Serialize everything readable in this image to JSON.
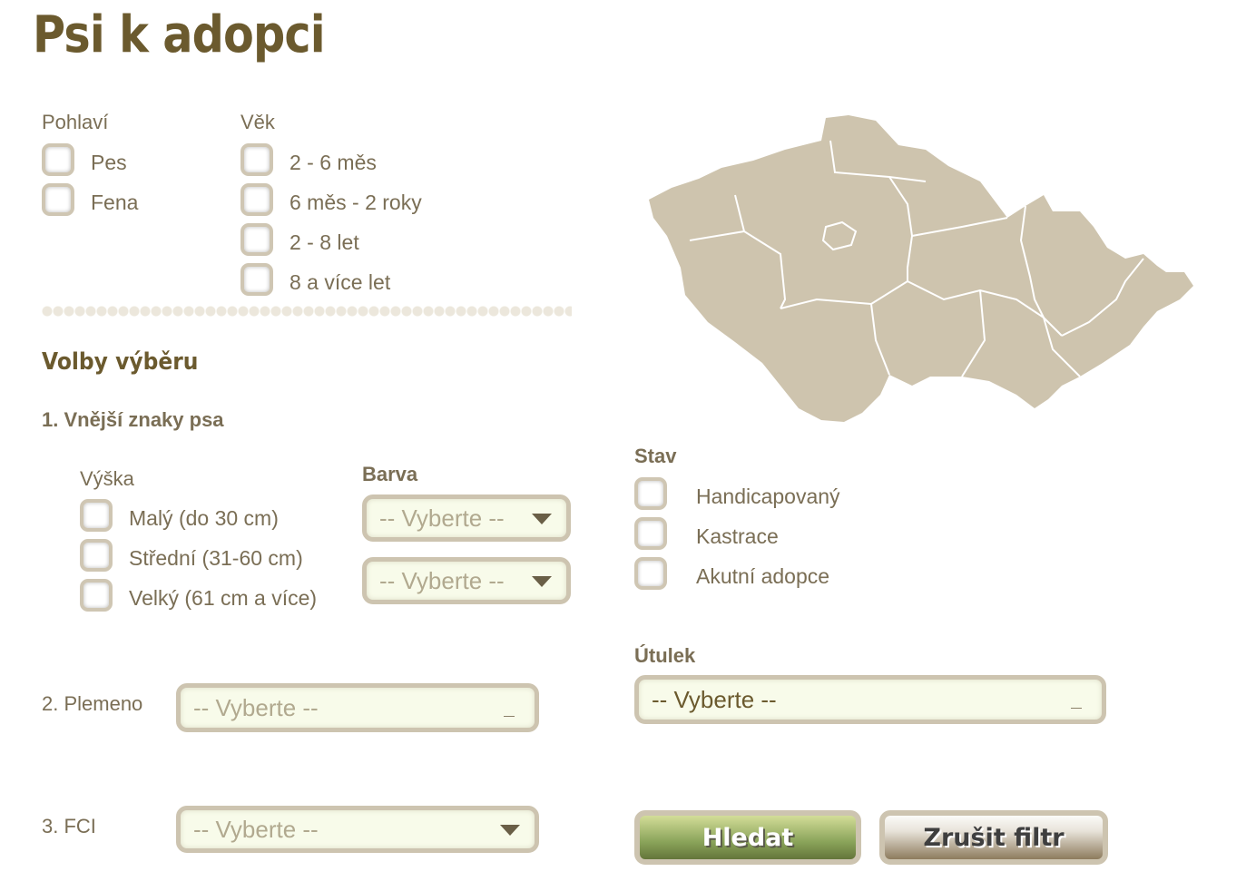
{
  "title": "Psi k adopci",
  "gender": {
    "label": "Pohlaví",
    "options": [
      "Pes",
      "Fena"
    ]
  },
  "age": {
    "label": "Věk",
    "options": [
      "2 - 6 měs",
      "6 měs - 2 roky",
      "2 - 8 let",
      "8 a více let"
    ]
  },
  "section_title": "Volby výběru",
  "external": {
    "label": "1. Vnější znaky psa",
    "height_label": "Výška",
    "heights": [
      "Malý (do 30 cm)",
      "Střední (31-60 cm)",
      "Velký (61 cm a více)"
    ],
    "color_label": "Barva",
    "color_selects": [
      "-- Vyberte --",
      "-- Vyberte --"
    ]
  },
  "breed": {
    "label": "2. Plemeno",
    "value": "-- Vyberte --"
  },
  "fci": {
    "label": "3. FCI",
    "value": "-- Vyberte --"
  },
  "status": {
    "label": "Stav",
    "options": [
      "Handicapovaný",
      "Kastrace",
      "Akutní adopce"
    ]
  },
  "shelter": {
    "label": "Útulek",
    "value": "-- Vyberte --"
  },
  "buttons": {
    "search": "Hledat",
    "reset": "Zrušit filtr"
  },
  "colors": {
    "title": "#6b5a2e",
    "map": "#cec4ae",
    "search_btn": "#87a052"
  }
}
